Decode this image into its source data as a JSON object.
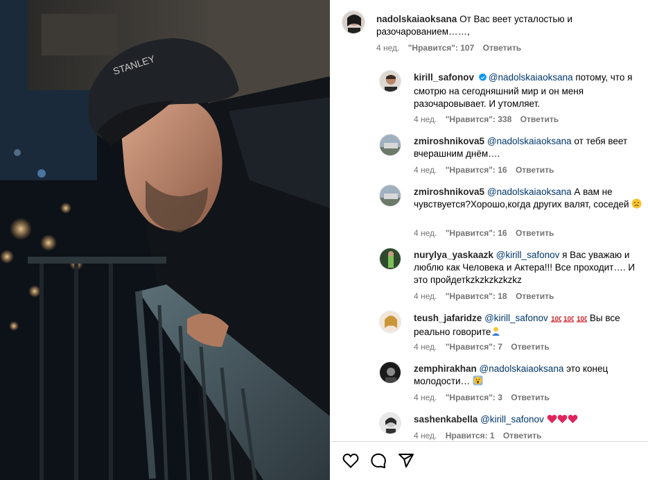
{
  "post": {
    "main_comment": {
      "username": "nadolskaiaoksana",
      "text": "От Вас веет усталостью и разочарованием……,",
      "age": "4 нед.",
      "likes": "\"Нравится\": 107",
      "reply": "Ответить"
    },
    "replies": [
      {
        "username": "kirill_safonov",
        "verified": true,
        "mention": "@nadolskaiaoksana",
        "text": " потому, что я смотрю на сегодняшний мир и он меня разочаровывает. И утомляет.",
        "age": "4 нед.",
        "likes": "\"Нравится\": 338",
        "reply": "Ответить"
      },
      {
        "username": "zmiroshnikova5",
        "mention": "@nadolskaiaoksana",
        "text": " от тебя веет вчерашним днём….",
        "age": "4 нед.",
        "likes": "\"Нравится\": 16",
        "reply": "Ответить"
      },
      {
        "username": "zmiroshnikova5",
        "mention": "@nadolskaiaoksana",
        "text": " А вам не чувствуется?Хорошо,когда других валят, соседей ",
        "emoji": "sad-face-emoji",
        "age": "4 нед.",
        "likes": "\"Нравится\": 16",
        "reply": "Ответить"
      },
      {
        "username": "nurylya_yaskaazk",
        "mention": "@kirill_safonov",
        "text": " я Вас уважаю и люблю как Человека и Актера!!! Все проходит…. И это пройдетkzkzkzkzkzkz",
        "age": "4 нед.",
        "likes": "\"Нравится\": 18",
        "reply": "Ответить"
      },
      {
        "username": "teush_jafaridze",
        "mention": "@kirill_safonov",
        "text": " Вы все реально говорите",
        "emoji": "hundred-emoji x3, person-bowing-emoji",
        "age": "4 нед.",
        "likes": "\"Нравится\": 7",
        "reply": "Ответить"
      },
      {
        "username": "zemphirakhan",
        "mention": "@nadolskaiaoksana",
        "text": " это конец молодости… ",
        "emoji": "screaming-face-emoji",
        "age": "4 нед.",
        "likes": "\"Нравится\": 3",
        "reply": "Ответить"
      },
      {
        "username": "sashenkabella",
        "mention": "@kirill_safonov",
        "text": "",
        "emoji": "red-heart-emoji x3",
        "age": "4 нед.",
        "likes": "Нравится: 1",
        "reply": "Ответить"
      }
    ]
  },
  "actions": {
    "like_icon": "heart-outline-icon",
    "comment_icon": "comment-bubble-icon",
    "share_icon": "paper-plane-icon"
  },
  "colors": {
    "mention": "#00376b",
    "meta": "#737373",
    "verified": "#0095f6",
    "heart": "#e0245e"
  }
}
